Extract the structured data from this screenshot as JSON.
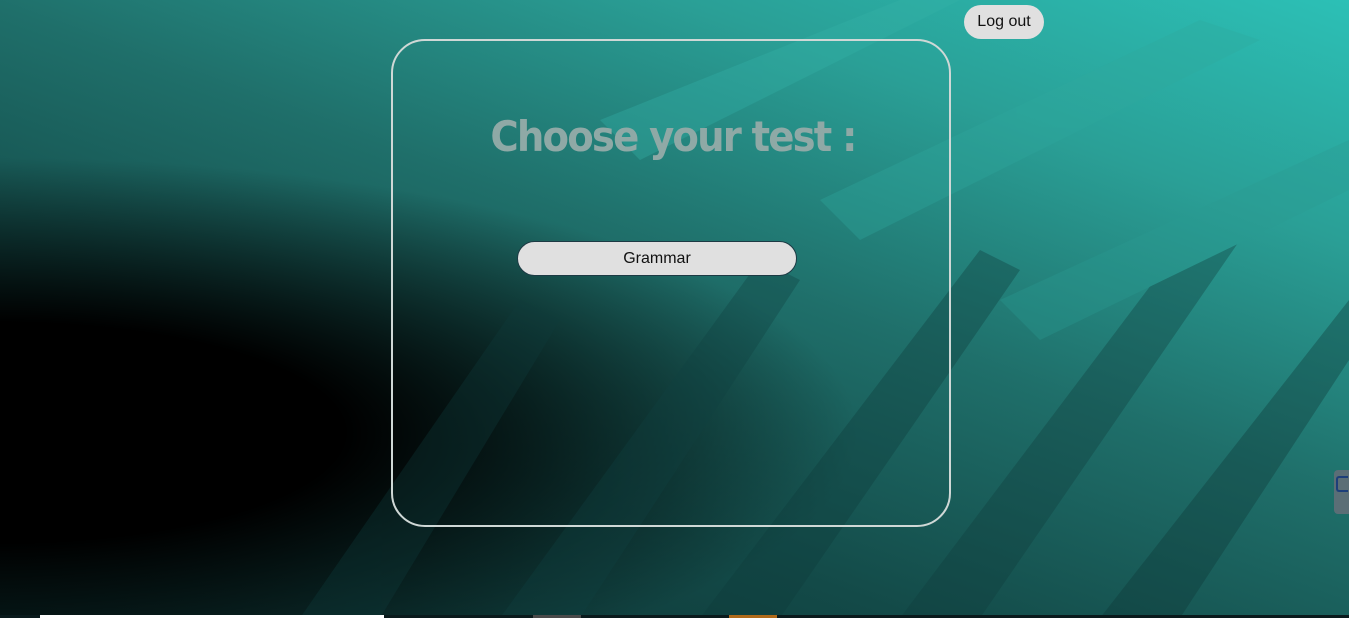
{
  "header": {
    "logout_label": "Log out"
  },
  "main": {
    "title": "Choose your test :",
    "tests": [
      {
        "label": "Grammar"
      }
    ]
  },
  "colors": {
    "accent_teal": "#2cc0b6",
    "title_color": "#8fa9a6",
    "button_bg": "#e0e0e0",
    "panel_border": "#cfd8d6"
  }
}
